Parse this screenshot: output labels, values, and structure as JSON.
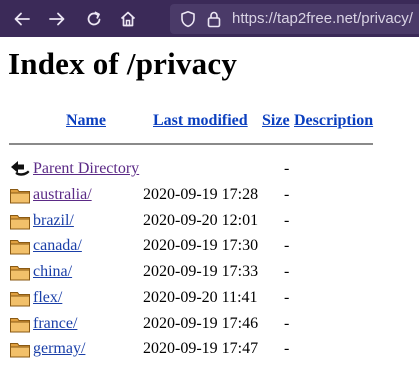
{
  "browser": {
    "url": "https://tap2free.net/privacy/",
    "toolbar_color": "#3b2a58",
    "icons": [
      "back-arrow-icon",
      "forward-arrow-icon",
      "reload-icon",
      "home-icon",
      "shield-icon",
      "lock-icon"
    ]
  },
  "page": {
    "title": "Index of /privacy",
    "columns": {
      "name": "Name",
      "last_modified": "Last modified",
      "size": "Size",
      "description": "Description"
    },
    "parent": {
      "label": "Parent Directory",
      "size": "-"
    },
    "entries": [
      {
        "name": "australia/",
        "modified": "2020-09-19 17:28",
        "size": "-",
        "visited": true
      },
      {
        "name": "brazil/",
        "modified": "2020-09-20 12:01",
        "size": "-",
        "visited": false
      },
      {
        "name": "canada/",
        "modified": "2020-09-19 17:30",
        "size": "-",
        "visited": false
      },
      {
        "name": "china/",
        "modified": "2020-09-19 17:33",
        "size": "-",
        "visited": false
      },
      {
        "name": "flex/",
        "modified": "2020-09-20 11:41",
        "size": "-",
        "visited": false
      },
      {
        "name": "france/",
        "modified": "2020-09-19 17:46",
        "size": "-",
        "visited": false
      },
      {
        "name": "germay/",
        "modified": "2020-09-19 17:47",
        "size": "-",
        "visited": false
      }
    ],
    "link_color": "#1a3fa8",
    "visited_color": "#5b2a86"
  }
}
